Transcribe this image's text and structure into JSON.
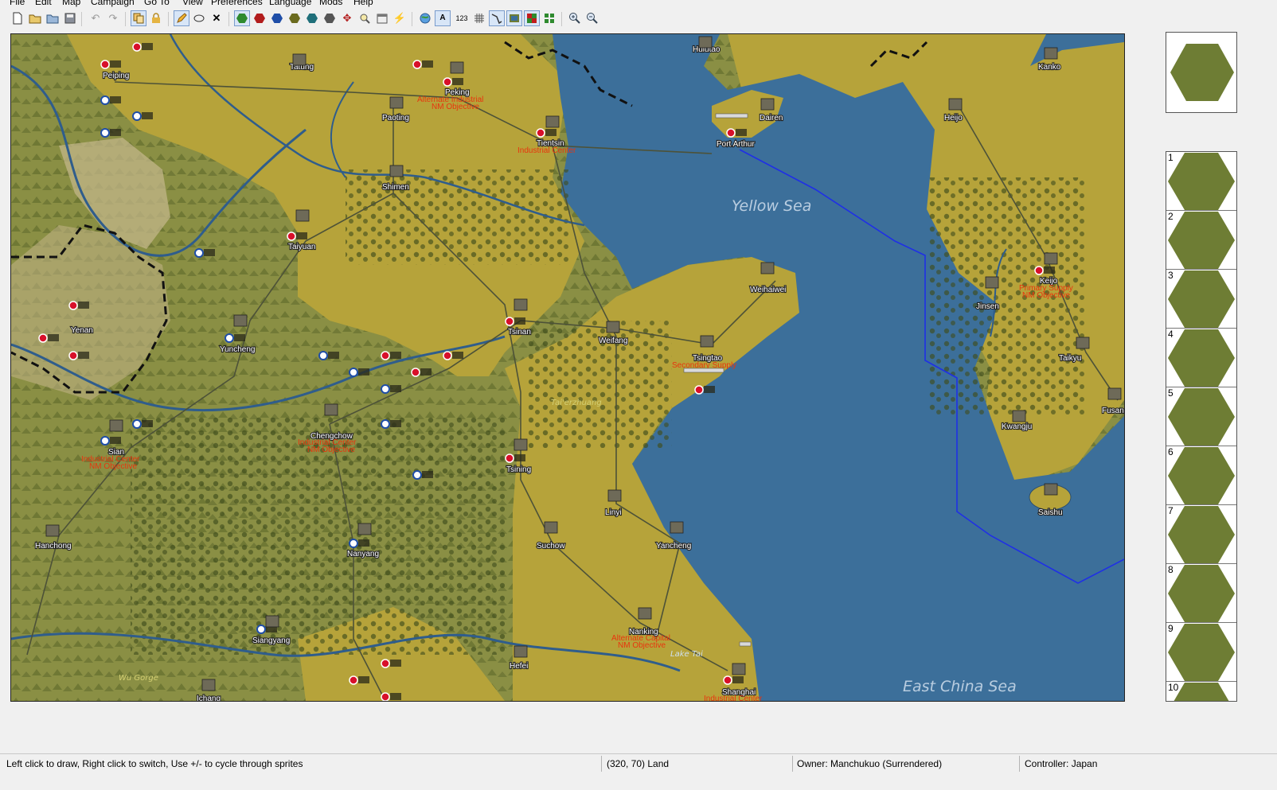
{
  "menu": {
    "items": [
      "File",
      "Edit",
      "Map",
      "Campaign",
      "Go To",
      "View",
      "Preferences",
      "Language",
      "Mods",
      "Help"
    ]
  },
  "toolbar": {
    "buttons": [
      {
        "icon": "new-document-icon"
      },
      {
        "icon": "open-folder-icon"
      },
      {
        "icon": "open-file-icon"
      },
      {
        "icon": "save-icon"
      },
      {
        "icon": "undo-icon"
      },
      {
        "icon": "redo-icon"
      },
      {
        "icon": "copy-icon"
      },
      {
        "icon": "lock-icon"
      },
      {
        "icon": "pencil-icon",
        "active": true
      },
      {
        "icon": "selection-icon"
      },
      {
        "icon": "delete-icon"
      },
      {
        "icon": "land-tile-icon",
        "active": true
      },
      {
        "icon": "red-tile-icon"
      },
      {
        "icon": "blue-tile-icon"
      },
      {
        "icon": "olive-tile-icon"
      },
      {
        "icon": "teal-tile-icon"
      },
      {
        "icon": "gray-tile-icon"
      },
      {
        "icon": "split-icon"
      },
      {
        "icon": "zoom-search-icon"
      },
      {
        "icon": "calendar-icon"
      },
      {
        "icon": "lightning-icon"
      },
      {
        "icon": "globe-icon"
      },
      {
        "icon": "text-size-icon"
      },
      {
        "icon": "numbers-icon",
        "text": "123"
      },
      {
        "icon": "grid-icon"
      },
      {
        "icon": "route-icon",
        "active": true
      },
      {
        "icon": "layers-icon",
        "active": true
      },
      {
        "icon": "color-grid-icon",
        "active": true
      },
      {
        "icon": "green-grid-icon"
      },
      {
        "icon": "zoom-in-icon"
      },
      {
        "icon": "zoom-out-icon"
      }
    ]
  },
  "map": {
    "cities": [
      {
        "name": "Tatung"
      },
      {
        "name": "Peking"
      },
      {
        "name": "Hulutao"
      },
      {
        "name": "Kanko"
      },
      {
        "name": "Paoting"
      },
      {
        "name": "Tientsin"
      },
      {
        "name": "Dairen"
      },
      {
        "name": "Port Arthur"
      },
      {
        "name": "Heijo"
      },
      {
        "name": "Shimen"
      },
      {
        "name": "Taiyuan"
      },
      {
        "name": "Weihaiwei"
      },
      {
        "name": "Keijo"
      },
      {
        "name": "Jinsen"
      },
      {
        "name": "Tsinan"
      },
      {
        "name": "Weifang"
      },
      {
        "name": "Tsingtao"
      },
      {
        "name": "Yuncheng"
      },
      {
        "name": "Taikyu"
      },
      {
        "name": "Fusan"
      },
      {
        "name": "Kwangju"
      },
      {
        "name": "Sian"
      },
      {
        "name": "Chengchow"
      },
      {
        "name": "Tsining"
      },
      {
        "name": "Saishu"
      },
      {
        "name": "Linyi"
      },
      {
        "name": "Suchow"
      },
      {
        "name": "Yancheng"
      },
      {
        "name": "Hanchong"
      },
      {
        "name": "Nanyang"
      },
      {
        "name": "Siangyang"
      },
      {
        "name": "Nanking"
      },
      {
        "name": "Hefei"
      },
      {
        "name": "Shanghai"
      },
      {
        "name": "Ichang"
      },
      {
        "name": "Peiping"
      },
      {
        "name": "Yenan"
      }
    ],
    "objective_labels": [
      {
        "text": "Alternate Industrial"
      },
      {
        "text": "NM Objective"
      },
      {
        "text": "Industrial Center"
      },
      {
        "text": "Secondary Supply"
      },
      {
        "text": "Primary Supply"
      },
      {
        "text": "NM Objective"
      },
      {
        "text": "Industrial Center"
      },
      {
        "text": "NM Objective"
      },
      {
        "text": "Industrial Center"
      },
      {
        "text": "NM Objective"
      },
      {
        "text": "Alternate Capital"
      },
      {
        "text": "NM Objective"
      },
      {
        "text": "Industrial Center"
      }
    ],
    "sea_labels": [
      {
        "text": "Yellow Sea"
      },
      {
        "text": "East China Sea"
      }
    ],
    "land_labels": [
      {
        "text": "Tai'erzhuang"
      },
      {
        "text": "Wu Gorge"
      },
      {
        "text": "Lake Tai"
      }
    ]
  },
  "preview": {
    "tile": "grassland-hex"
  },
  "palette": {
    "items": [
      {
        "num": "1"
      },
      {
        "num": "2"
      },
      {
        "num": "3"
      },
      {
        "num": "4"
      },
      {
        "num": "5"
      },
      {
        "num": "6"
      },
      {
        "num": "7"
      },
      {
        "num": "8"
      },
      {
        "num": "9"
      },
      {
        "num": "10"
      }
    ]
  },
  "status": {
    "hint": "Left click to draw, Right click to switch, Use +/- to cycle through sprites",
    "coords": "(320, 70) Land",
    "owner": "Owner:  Manchukuo (Surrendered)",
    "controller": "Controller:  Japan"
  },
  "colors": {
    "sea": "#3c6f9a",
    "plains": "#b6a33a",
    "steppe": "#8a8f44",
    "hills": "#6e7d34",
    "axis_marker": "#d8102a",
    "china_marker": "#1f4ea8"
  }
}
